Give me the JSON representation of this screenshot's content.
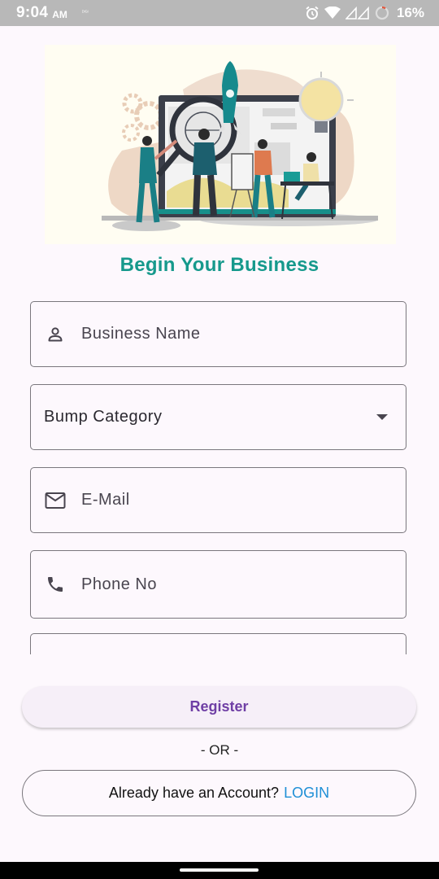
{
  "status_bar": {
    "time": "9:04",
    "ampm": "AM",
    "tiny": "ᴰᴵᴳᴵ",
    "battery": "16%"
  },
  "header": {
    "title": "Begin Your Business"
  },
  "form": {
    "business_name_label": "Business Name",
    "category_label": "Bump Category",
    "email_label": "E-Mail",
    "phone_label": "Phone No"
  },
  "actions": {
    "register_label": "Register",
    "or_label": "- OR -",
    "account_prompt": "Already have an Account?",
    "login_label": "LOGIN"
  },
  "colors": {
    "accent": "#16998c",
    "register_text": "#6f3fa5",
    "link": "#1e8fd6",
    "background": "#fdf8fd"
  },
  "icons": [
    "alarm-icon",
    "wifi-icon",
    "signal-icon",
    "battery-icon",
    "person-icon",
    "dropdown-arrow-icon",
    "mail-icon",
    "phone-icon"
  ]
}
